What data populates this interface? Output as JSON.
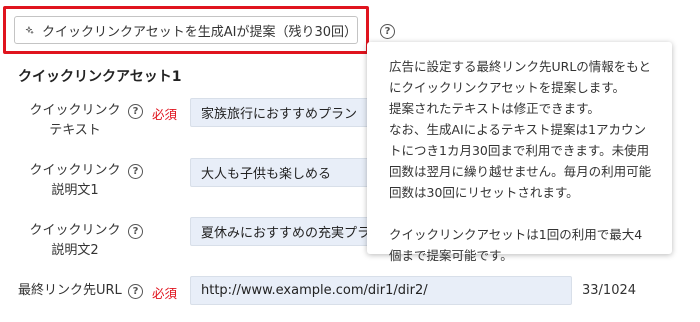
{
  "suggest": {
    "label": "クイックリンクアセットを生成AIが提案（残り30回）"
  },
  "section": {
    "title": "クイックリンクアセット1"
  },
  "fields": {
    "link_text": {
      "label_line1": "クイックリンク",
      "label_line2": "テキスト",
      "required": "必須",
      "value": "家族旅行におすすめプラン"
    },
    "desc1": {
      "label_line1": "クイックリンク",
      "label_line2": "説明文1",
      "value": "大人も子供も楽しめる"
    },
    "desc2": {
      "label_line1": "クイックリンク",
      "label_line2": "説明文2",
      "value": "夏休みにおすすめの充実プラン"
    },
    "final_url": {
      "label": "最終リンク先URL",
      "required": "必須",
      "value": "http://www.example.com/dir1/dir2/",
      "counter": "33/1024"
    }
  },
  "tooltip": {
    "para1": "広告に設定する最終リンク先URLの情報をもとにクイックリンクアセットを提案します。",
    "para2": "提案されたテキストは修正できます。",
    "para3": "なお、生成AIによるテキスト提案は1アカウントにつき1カ月30回まで利用できます。未使用回数は翌月に繰り越せません。毎月の利用可能回数は30回にリセットされます。",
    "para4": "クイックリンクアセットは1回の利用で最大4個まで提案可能です。"
  },
  "icons": {
    "sparkle": "sparkle-icon",
    "help": "help-circle-icon"
  },
  "colors": {
    "highlight": "#e0141e",
    "required": "#e0141e",
    "field_bg": "#e8eef8"
  }
}
